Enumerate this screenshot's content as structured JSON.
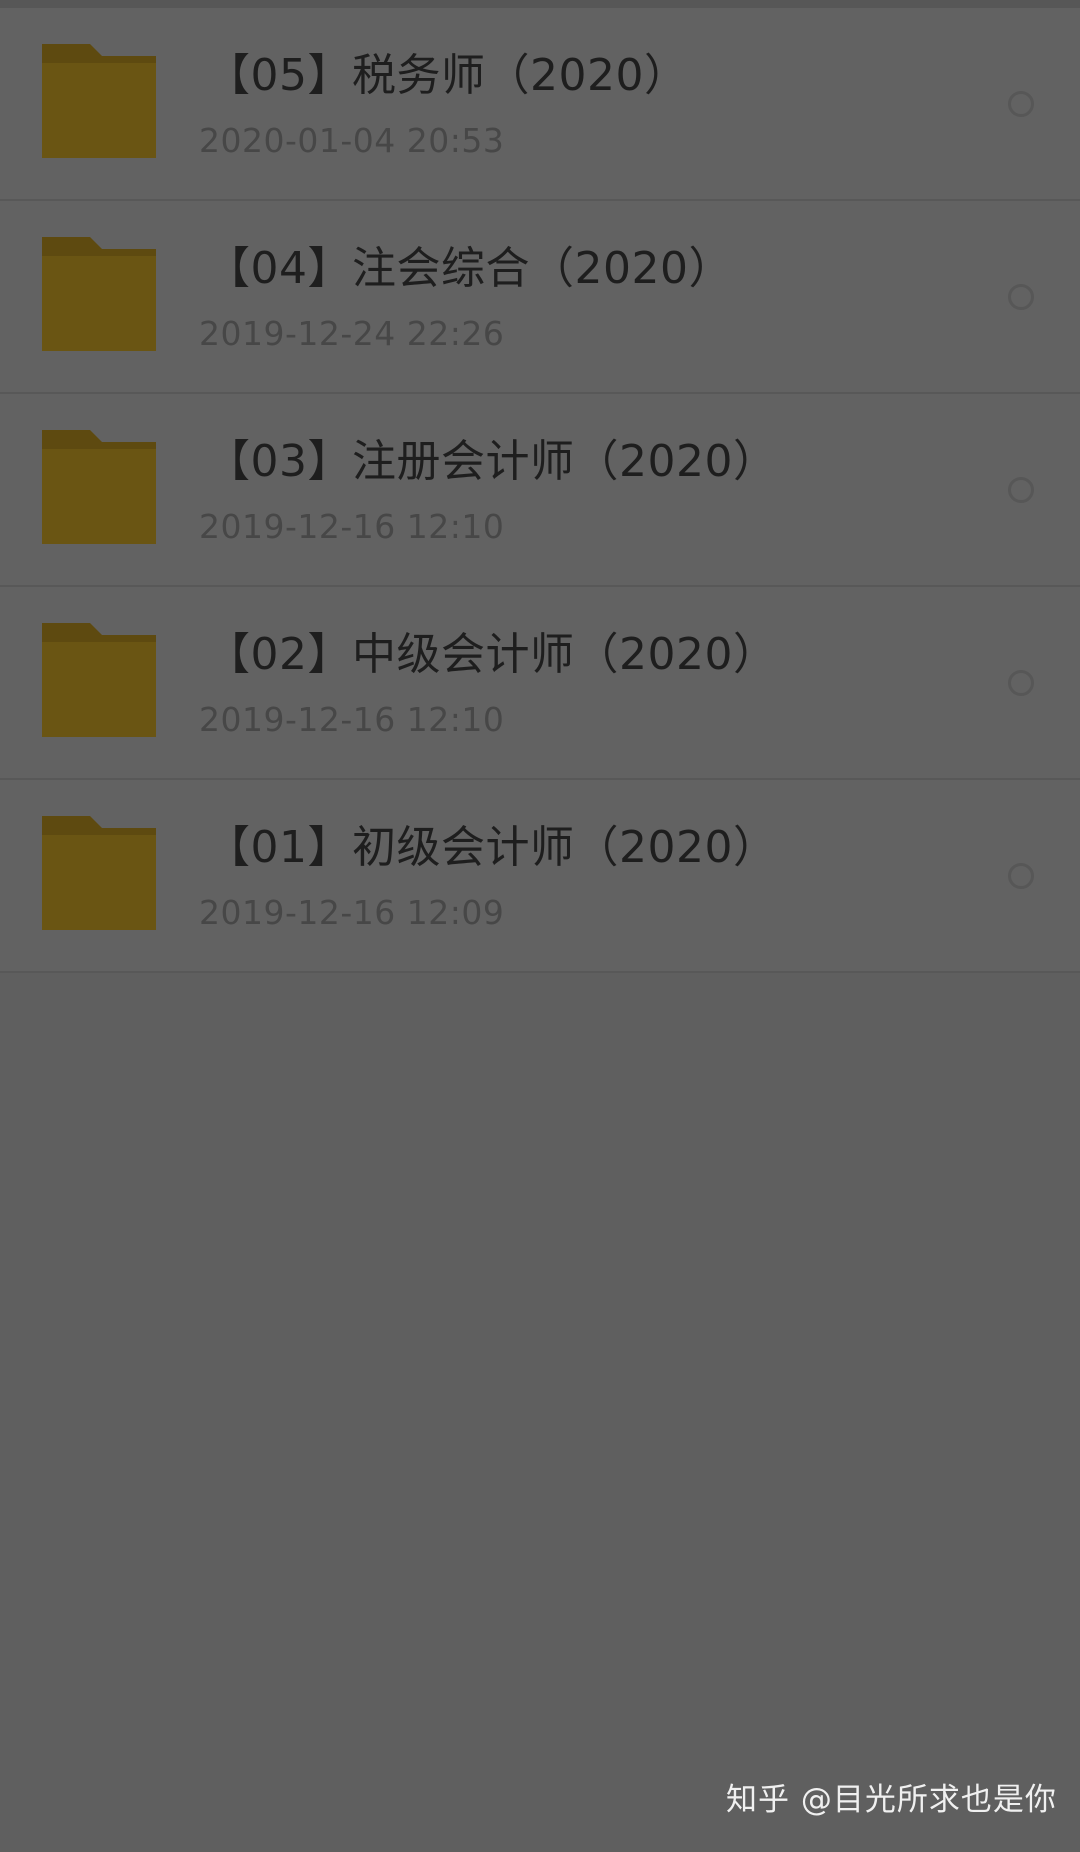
{
  "colors": {
    "overlay_background": "#5f5f5f",
    "row_background": "#626262",
    "folder_body": "#6a5513",
    "folder_tab": "#5e4a10",
    "title_text": "#1e1e1e",
    "date_text": "#474747",
    "watermark_text": "#f0f0f0"
  },
  "files": [
    {
      "icon": "folder-icon",
      "name": "【05】税务师（2020）",
      "modified": "2020-01-04  20:53",
      "selected": false
    },
    {
      "icon": "folder-icon",
      "name": "【04】注会综合（2020）",
      "modified": "2019-12-24  22:26",
      "selected": false
    },
    {
      "icon": "folder-icon",
      "name": "【03】注册会计师（2020）",
      "modified": "2019-12-16  12:10",
      "selected": false
    },
    {
      "icon": "folder-icon",
      "name": "【02】中级会计师（2020）",
      "modified": "2019-12-16  12:10",
      "selected": false
    },
    {
      "icon": "folder-icon",
      "name": "【01】初级会计师（2020）",
      "modified": "2019-12-16  12:09",
      "selected": false
    }
  ],
  "watermark": "知乎 @目光所求也是你"
}
